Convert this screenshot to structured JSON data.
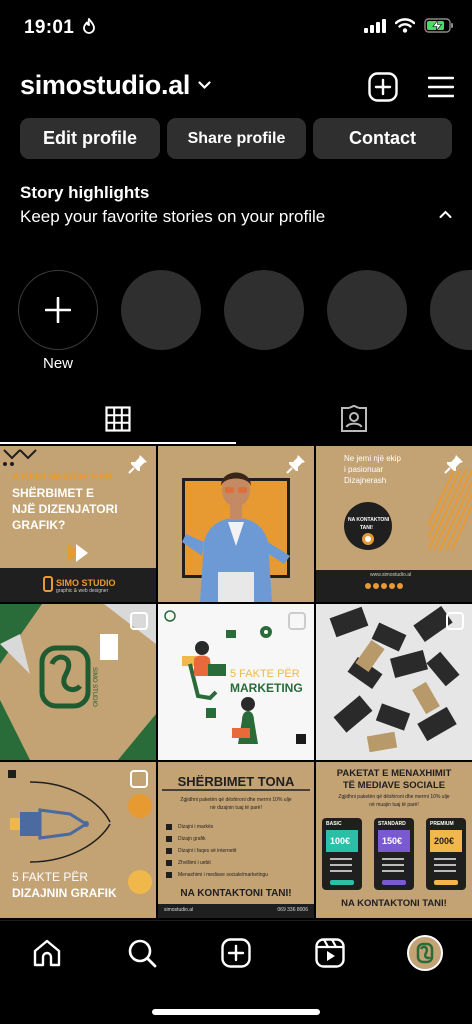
{
  "status_bar": {
    "time": "19:01"
  },
  "profile": {
    "username": "simostudio.al"
  },
  "buttons": {
    "edit": "Edit profile",
    "share": "Share profile",
    "contact": "Contact"
  },
  "highlights": {
    "title": "Story highlights",
    "subtitle": "Keep your favorite stories on your profile",
    "new_label": "New"
  },
  "posts": {
    "p1": {
      "line1": "A KENI NEVOJË PËR",
      "line2": "SHËRBIMET E",
      "line3": "NJË DIZENJATORI",
      "line4": "GRAFIK?",
      "brand": "SIMO STUDIO",
      "brand_sub": "graphic & web designer"
    },
    "p3": {
      "line1": "Ne jemi një ekip",
      "line2": "i pasionuar",
      "line3": "Dizajnerash",
      "cta1": "NA KONTAKTONI",
      "cta2": "TANI!",
      "url": "www.simostudio.al"
    },
    "p4": {
      "brand": "SIMO STUDIO"
    },
    "p5": {
      "line1": "5 FAKTE PËR",
      "line2": "MARKETING"
    },
    "p7": {
      "line1": "5 FAKTE PËR",
      "line2": "DIZAJNIN GRAFIK"
    },
    "p8": {
      "title": "SHËRBIMET TONA",
      "sub1": "Zgjidhni paketën që dëshironi dhe merrni 10% ulje",
      "sub2": "në dizajnin tuaj të parë!",
      "items": [
        "Dizajni i markës",
        "Dizajn grafik",
        "Dizajni i faqes së internetit",
        "Zhvillimi i uebit",
        "Menaxhimi i mediave sociale/marketingu"
      ],
      "cta": "NA KONTAKTONI TANI!",
      "footer_left": "simostudio.al",
      "footer_right": "069 336 8006"
    },
    "p9": {
      "title1": "PAKETAT E MENAXHIMIT",
      "title2": "TË MEDIAVE SOCIALE",
      "sub1": "Zgjidhni paketën që dëshironi dhe merrni 10% ulje",
      "sub2": "në muajin tuaj të parë!",
      "plans": [
        {
          "name": "BASIC",
          "price": "100€"
        },
        {
          "name": "STANDARD",
          "price": "150€"
        },
        {
          "name": "PREMIUM",
          "price": "200€"
        }
      ],
      "cta": "NA KONTAKTONI TANI!"
    }
  },
  "colors": {
    "tan": "#c3a274",
    "dark": "#1a1a1a",
    "green": "#2a6b3a",
    "orange": "#e3a13c",
    "button_bg": "#2f2f2f"
  }
}
